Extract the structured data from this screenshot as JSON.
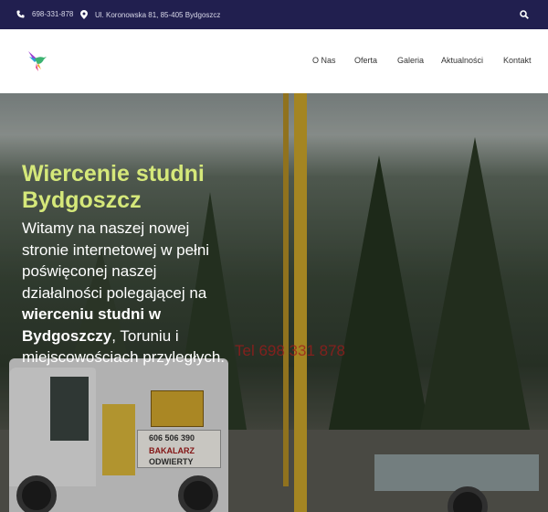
{
  "topbar": {
    "phone": "698-331-878",
    "address": "Ul. Koronowska 81, 85-405 Bydgoszcz",
    "icons": {
      "phone": "phone-icon",
      "location": "map-pin-icon",
      "search": "search-icon"
    }
  },
  "header": {
    "logo_icon": "hummingbird-logo-icon",
    "nav": [
      "O Nas",
      "Oferta",
      "Galeria",
      "Aktualności",
      "Kontakt"
    ]
  },
  "hero": {
    "title": "Wiercenie studni Bydgoszcz",
    "text_intro": "Witamy na naszej nowej stronie internetowej w pełni poświęconej naszej działalności polegającej na",
    "text_bold": "wierceniu studni w Bydgoszczy",
    "text_outro": ", Toruniu i miejscowościach przyległych.",
    "tel": "Tel 698 331 878",
    "truck_phone": "606 506 390",
    "truck_name": "BAKALARZ",
    "truck_label": "ODWIERTY"
  },
  "colors": {
    "topbar_bg": "#211f4f",
    "title_color": "#d5e87a",
    "tel_color": "#a11b1b"
  }
}
